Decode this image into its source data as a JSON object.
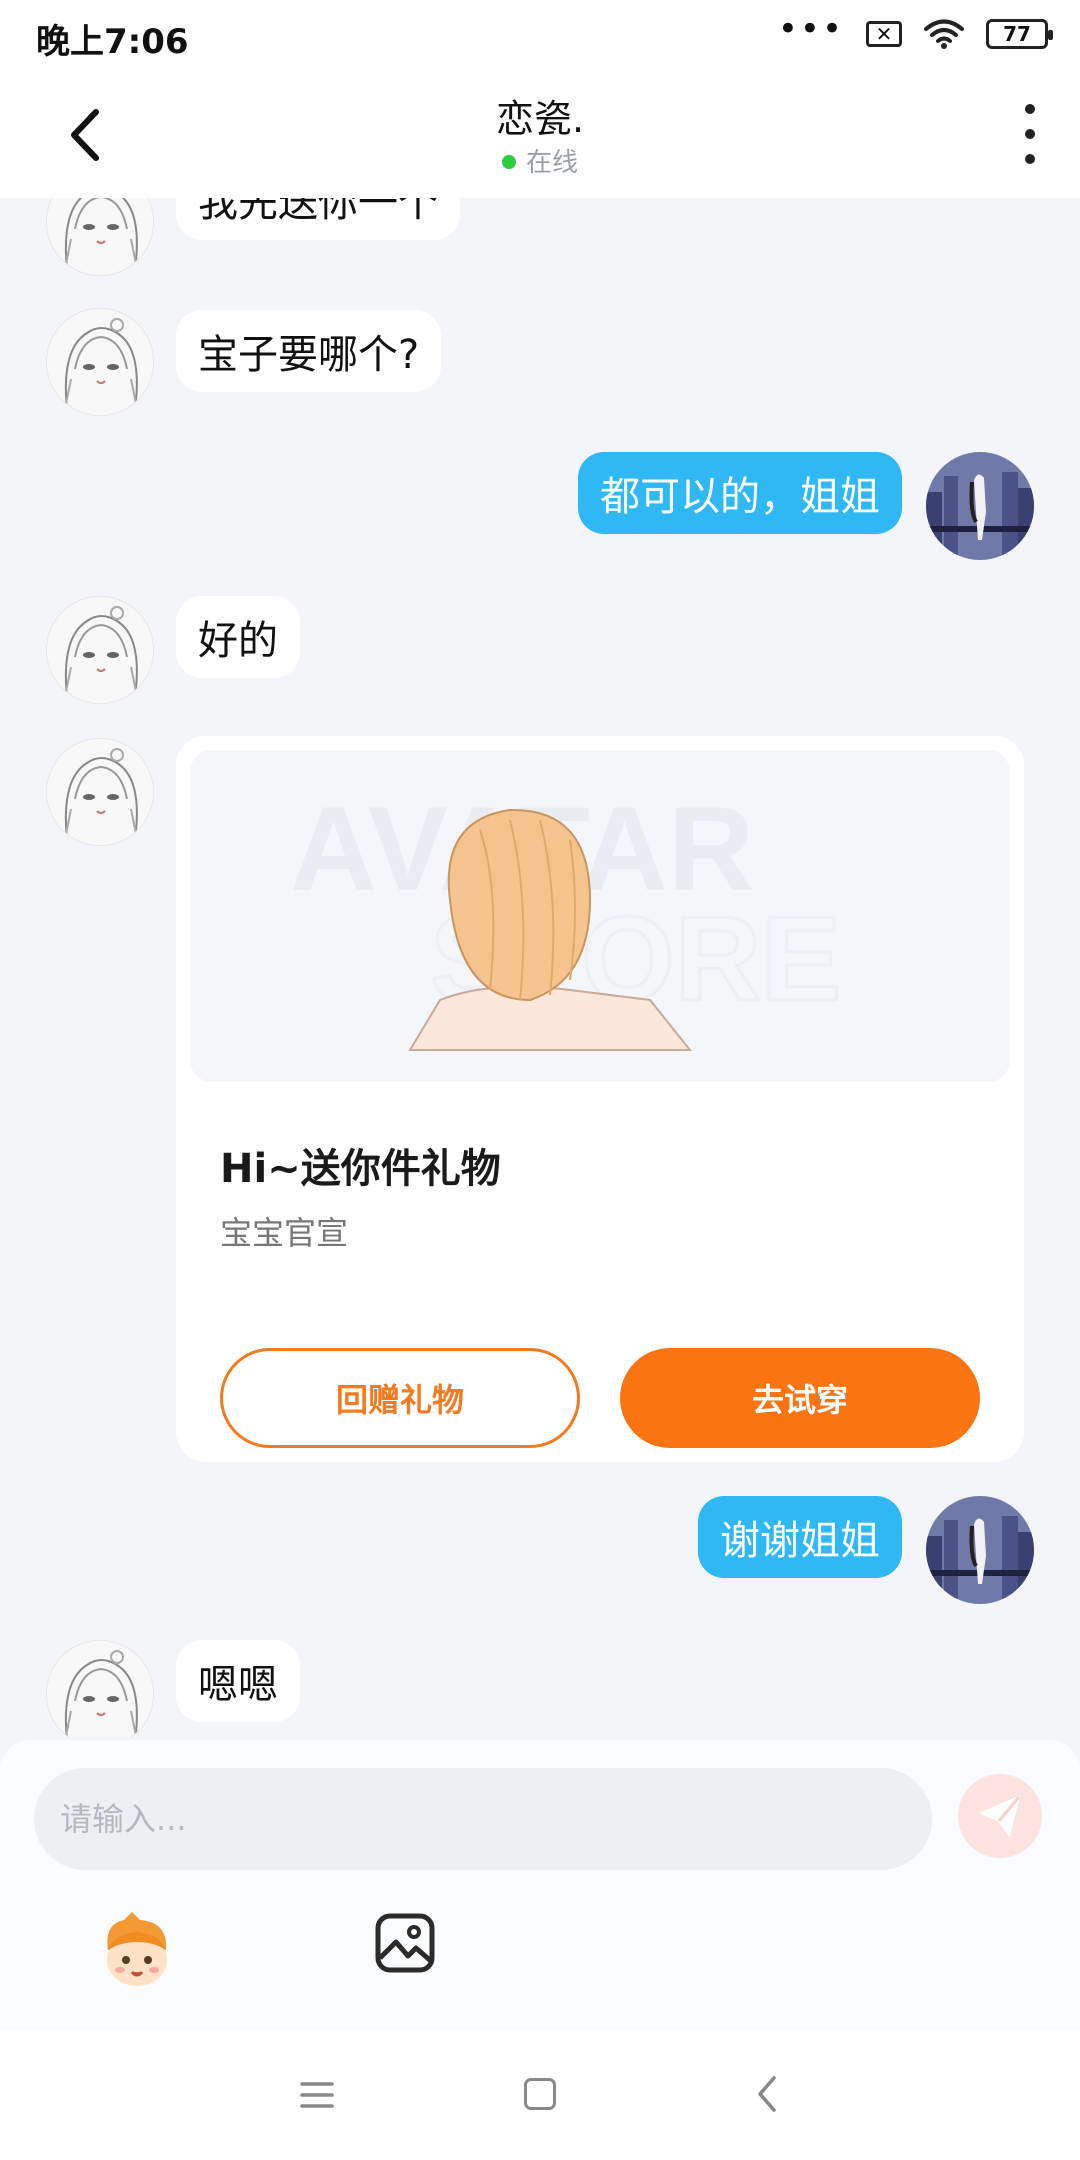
{
  "status_bar": {
    "time": "晚上7:06",
    "signal_dots": "•••",
    "battery": "77"
  },
  "header": {
    "title": "恋瓷.",
    "status": "在线"
  },
  "messages": [
    {
      "side": "left",
      "text": "我先送你一个"
    },
    {
      "side": "left",
      "text": "宝子要哪个?"
    },
    {
      "side": "right",
      "text": "都可以的，姐姐"
    },
    {
      "side": "left",
      "text": "好的"
    },
    {
      "side": "right",
      "text": "谢谢姐姐"
    },
    {
      "side": "left",
      "text": "嗯嗯"
    }
  ],
  "gift_card": {
    "watermark_line1": "AVATAR",
    "watermark_line2": "STORE",
    "title": "Hi~送你件礼物",
    "subtitle": "宝宝官宣",
    "return_gift_button": "回赠礼物",
    "try_on_button": "去试穿"
  },
  "input": {
    "placeholder": "请输入..."
  },
  "colors": {
    "bubble_right": "#2fb8f3",
    "accent_orange": "#fb7412",
    "online_green": "#2ecc40"
  },
  "icons": {
    "back": "chevron-left-icon",
    "more": "more-vertical-icon",
    "send": "send-icon",
    "emoji": "mascot-emoji-icon",
    "image": "image-icon"
  }
}
